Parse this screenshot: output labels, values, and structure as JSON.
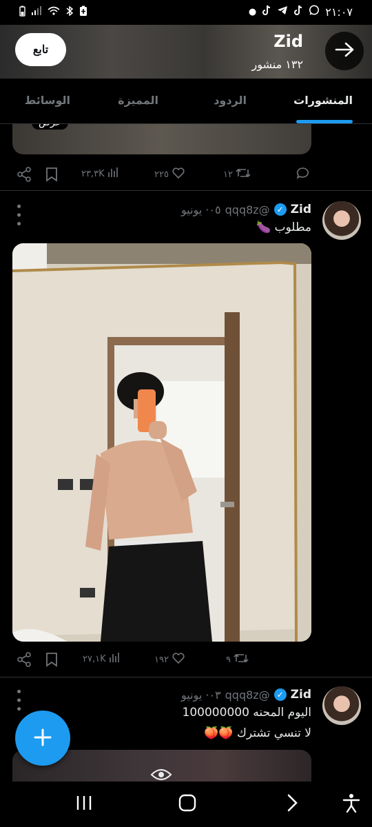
{
  "status_bar": {
    "time": "٢١:٠٧",
    "left_icons": [
      "battery-icon",
      "signal-icon",
      "wifi-icon",
      "bluetooth-icon",
      "battery-saver-icon"
    ],
    "right_icons": [
      "dot-icon",
      "tiktok-icon",
      "telegram-icon",
      "tiktok-icon",
      "whatsapp-icon"
    ]
  },
  "header": {
    "name": "Zid",
    "post_count": "١٣٢ منشور",
    "follow_label": "تابع"
  },
  "tabs": [
    {
      "label": "المنشورات",
      "active": true
    },
    {
      "label": "الردود",
      "active": false
    },
    {
      "label": "المميزة",
      "active": false
    },
    {
      "label": "الوسائط",
      "active": false
    }
  ],
  "prev_post": {
    "media_badge": "عرض",
    "views": "٢٣,٣K",
    "likes": "٢٢٥",
    "retweets": "١٢"
  },
  "posts": [
    {
      "name": "Zid",
      "handle": "@qqq8z",
      "date": "٠٥· يونيو",
      "text": "مطلوب 🍆",
      "views": "٢٧,١K",
      "likes": "١٩٢",
      "retweets": "٩"
    },
    {
      "name": "Zid",
      "handle": "@qqq8z",
      "date": "٠٣· يونيو",
      "text_line1": "اليوم المحنه 100000000",
      "text_line2": "لا تنسي تشترك 🍑🍑"
    }
  ],
  "colors": {
    "accent": "#1d9bf0",
    "background": "#000000",
    "muted": "#71767b",
    "divider": "#2f3336"
  }
}
